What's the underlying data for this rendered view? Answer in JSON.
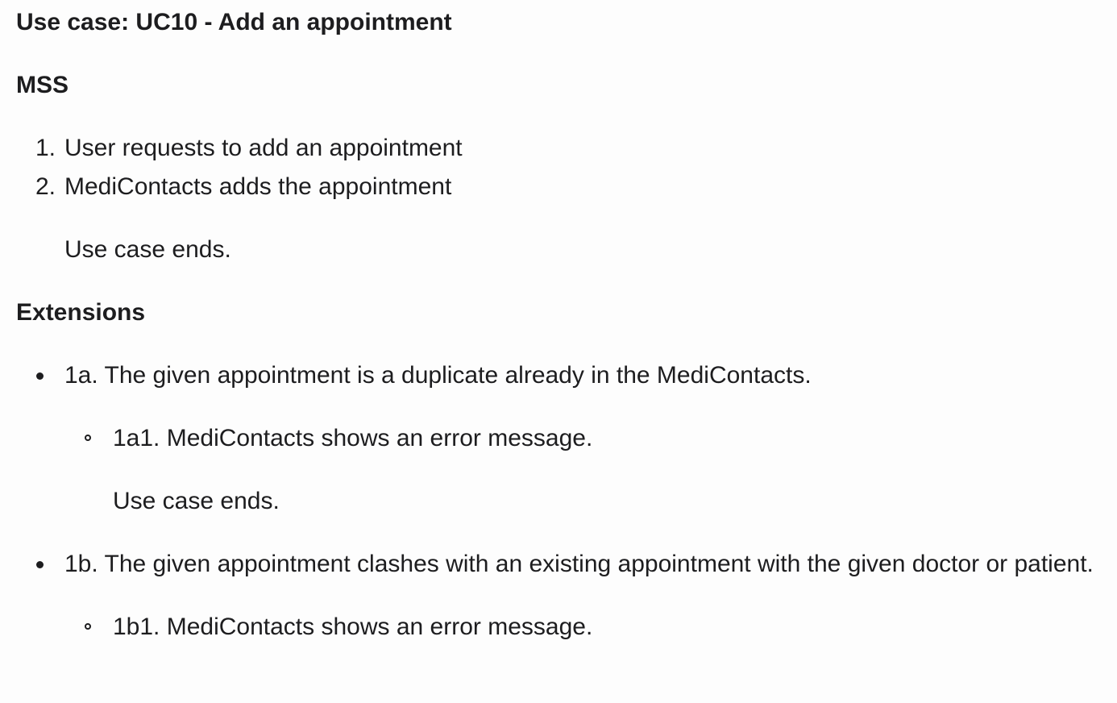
{
  "title": "Use case: UC10 - Add an appointment",
  "mss": {
    "heading": "MSS",
    "steps": [
      {
        "num": "1.",
        "text": "User requests to add an appointment"
      },
      {
        "num": "2.",
        "text": "MediContacts adds the appointment"
      }
    ],
    "ending": "Use case ends."
  },
  "extensions": {
    "heading": "Extensions",
    "items": [
      {
        "text": "1a. The given appointment is a duplicate already in the MediContacts.",
        "sub": {
          "text": "1a1. MediContacts shows an error message.",
          "ending": "Use case ends."
        }
      },
      {
        "text": "1b. The given appointment clashes with an existing appointment with the given doctor or patient.",
        "sub": {
          "text": "1b1. MediContacts shows an error message."
        }
      }
    ]
  }
}
